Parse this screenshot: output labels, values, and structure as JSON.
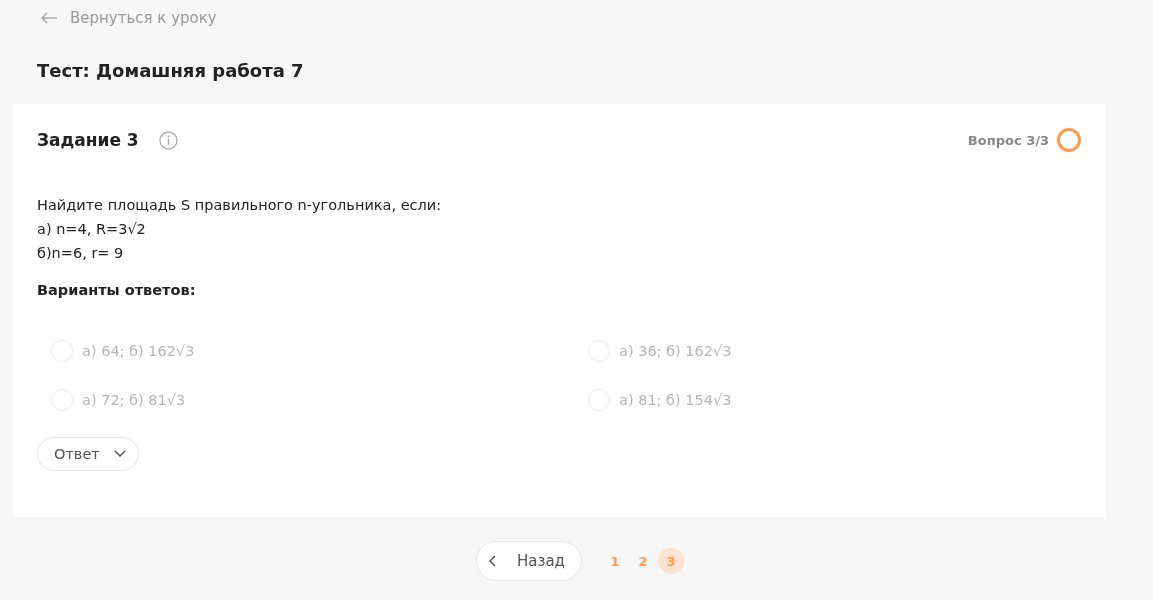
{
  "back_link": "Вернуться к уроку",
  "test_title": "Тест: Домашняя работа 7",
  "task": {
    "title": "Задание 3",
    "progress": "Вопрос 3/3",
    "question_lines": [
      "Найдите площадь S правильного n-угольника, если:",
      "а) n=4, R=3√2",
      "б)n=6, r= 9"
    ],
    "options_heading": "Варианты ответов:",
    "options": [
      {
        "label": "а) 64; б) 162√3",
        "selected": false,
        "disabled": true
      },
      {
        "label": "а) 36; б) 162√3",
        "selected": false,
        "disabled": true
      },
      {
        "label": "а) 72; б) 81√3",
        "selected": false,
        "disabled": true
      },
      {
        "label": "а) 81; б) 154√3",
        "selected": false,
        "disabled": true
      }
    ],
    "answer_button": "Ответ"
  },
  "pagination": {
    "back_button": "Назад",
    "pages": [
      {
        "label": "1",
        "selected": false
      },
      {
        "label": "2",
        "selected": false
      },
      {
        "label": "3",
        "selected": true
      }
    ]
  }
}
